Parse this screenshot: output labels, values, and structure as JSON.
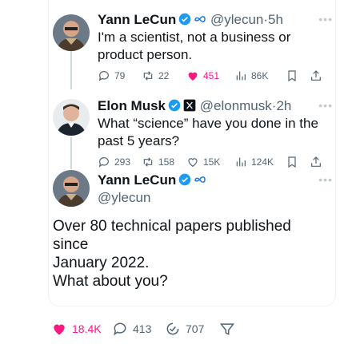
{
  "tweets": [
    {
      "name": "Yann LeCun",
      "handle": "@ylecun",
      "time": "5h",
      "text": "I'm a scientist, not a business or product person.",
      "actions": {
        "replies": "79",
        "retweets": "22",
        "likes": "451",
        "views": "86K"
      }
    },
    {
      "name": "Elon Musk",
      "handle": "@elonmusk",
      "time": "2h",
      "text": "What “science” have you done in the past 5 years?",
      "actions": {
        "replies": "293",
        "retweets": "158",
        "likes": "15K",
        "views": "124K"
      }
    }
  ],
  "main": {
    "name": "Yann LeCun",
    "handle": "@ylecun",
    "text_line1": "Over 80 technical papers published since",
    "text_line2": "January 2022.",
    "text_line3": "What about you?",
    "actions": {
      "likes": "18.4K",
      "replies": "413",
      "retweets": "707"
    }
  },
  "colors": {
    "like": "#f91880",
    "verified": "#1d9bf0",
    "muted": "#536471"
  },
  "icons": [
    "verified-icon",
    "meta-badge-icon",
    "x-badge-icon",
    "reply-icon",
    "retweet-icon",
    "like-icon",
    "views-icon",
    "bookmark-icon",
    "share-icon",
    "more-icon"
  ]
}
